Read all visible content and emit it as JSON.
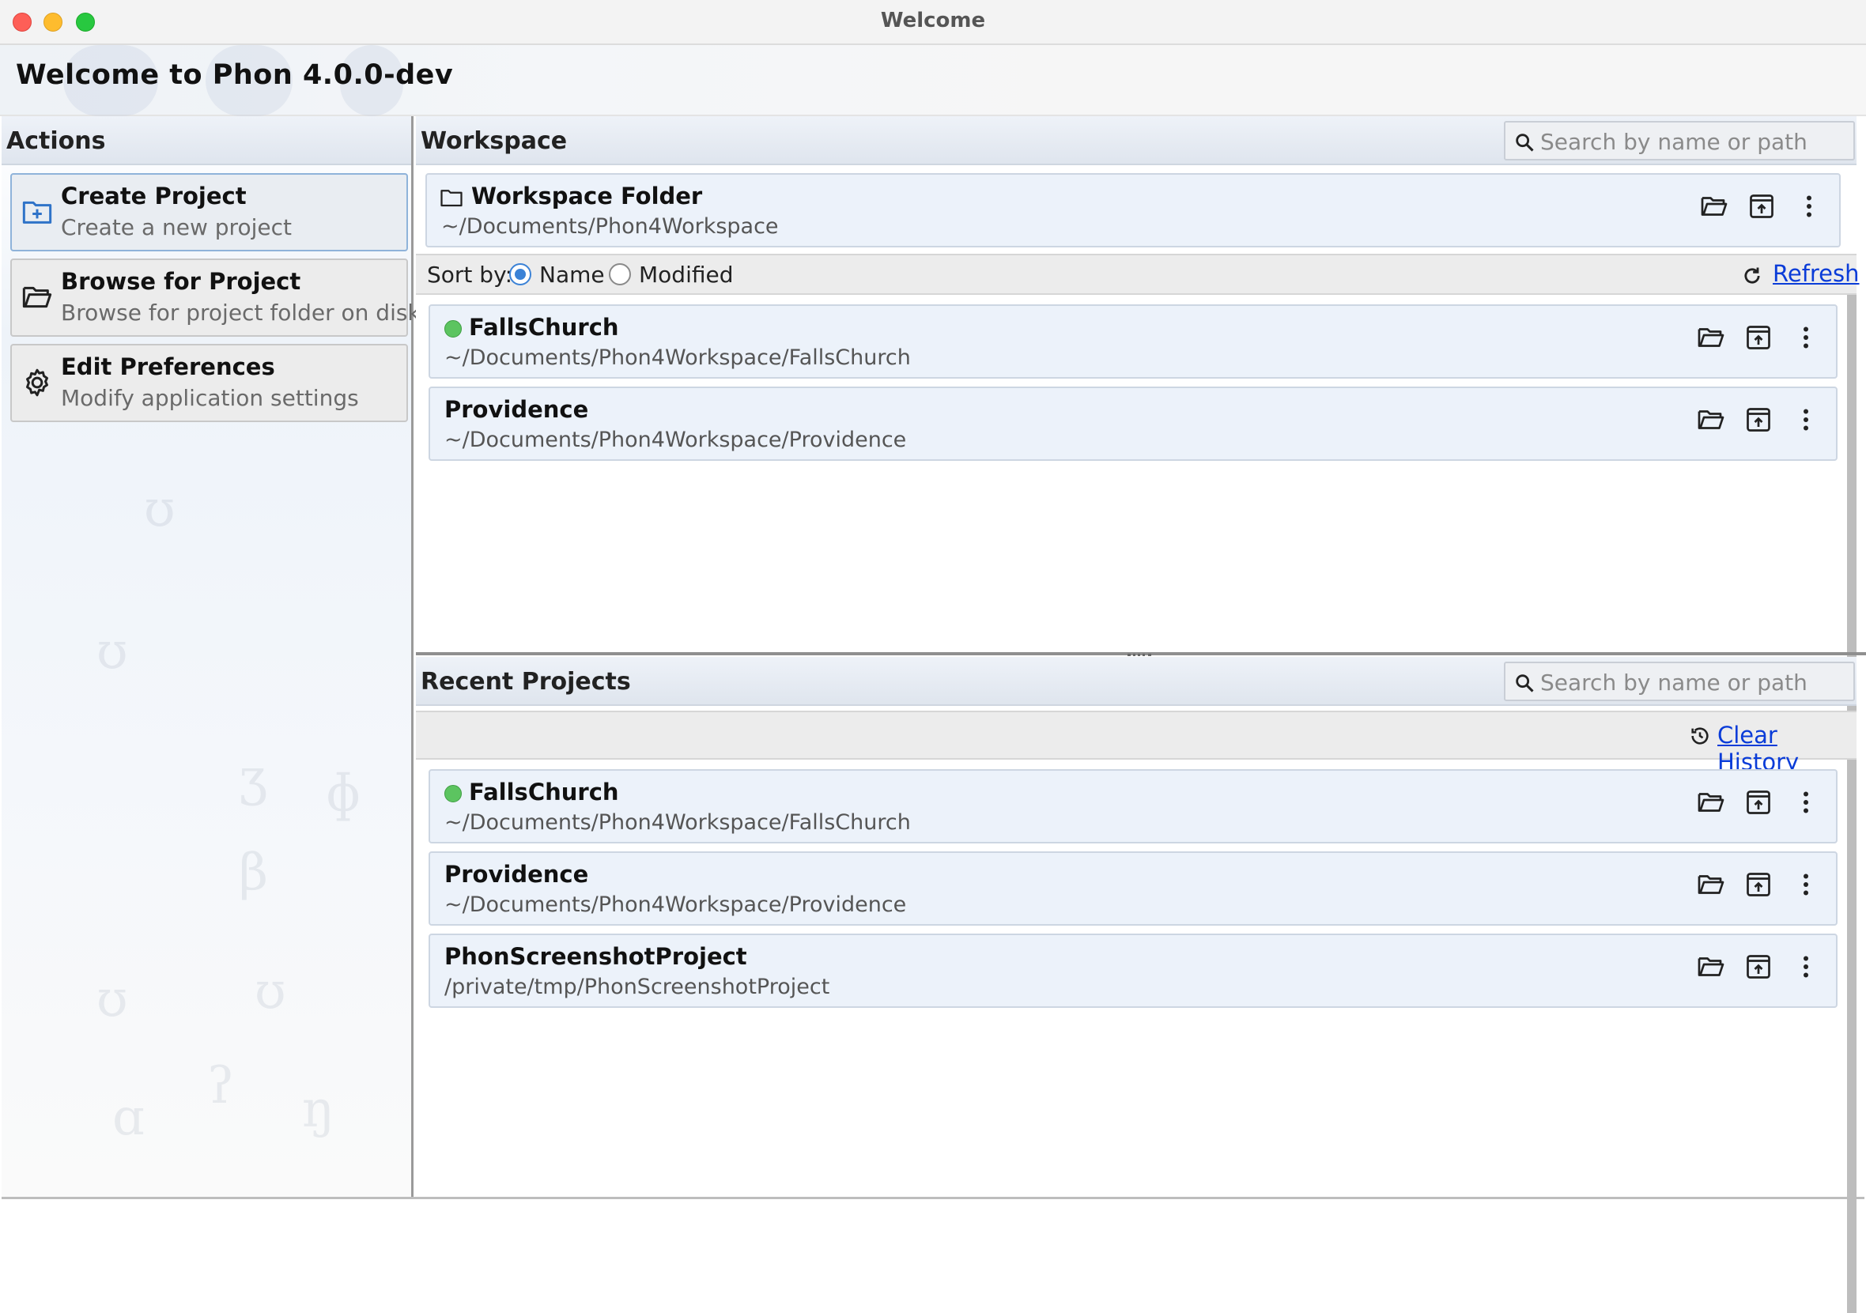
{
  "window": {
    "title": "Welcome"
  },
  "header": {
    "title": "Welcome to Phon 4.0.0-dev"
  },
  "actions": {
    "title": "Actions",
    "items": [
      {
        "label": "Create Project",
        "description": "Create a new project",
        "icon": "folder-plus-icon"
      },
      {
        "label": "Browse for Project",
        "description": "Browse for project folder on disk",
        "icon": "folder-open-icon"
      },
      {
        "label": "Edit Preferences",
        "description": "Modify application settings",
        "icon": "gear-icon"
      }
    ]
  },
  "workspace": {
    "title": "Workspace",
    "search_placeholder": "Search by name or path",
    "folder": {
      "label": "Workspace Folder",
      "path": "~/Documents/Phon4Workspace"
    },
    "sort_label": "Sort by:",
    "sort_options": [
      "Name",
      "Modified"
    ],
    "sort_selected": "Name",
    "refresh_label": "Refresh",
    "projects": [
      {
        "name": "FallsChurch",
        "path": "~/Documents/Phon4Workspace/FallsChurch",
        "open": true
      },
      {
        "name": "Providence",
        "path": "~/Documents/Phon4Workspace/Providence",
        "open": false
      }
    ]
  },
  "recent": {
    "title": "Recent Projects",
    "search_placeholder": "Search by name or path",
    "clear_label": "Clear History",
    "projects": [
      {
        "name": "FallsChurch",
        "path": "~/Documents/Phon4Workspace/FallsChurch",
        "open": true
      },
      {
        "name": "Providence",
        "path": "~/Documents/Phon4Workspace/Providence",
        "open": false
      },
      {
        "name": "PhonScreenshotProject",
        "path": "/private/tmp/PhonScreenshotProject",
        "open": false
      }
    ]
  },
  "colors": {
    "accent": "#3b82d6",
    "link": "#0a3cd8",
    "open_indicator": "#5cc460",
    "card_bg": "#ecf2fa"
  }
}
